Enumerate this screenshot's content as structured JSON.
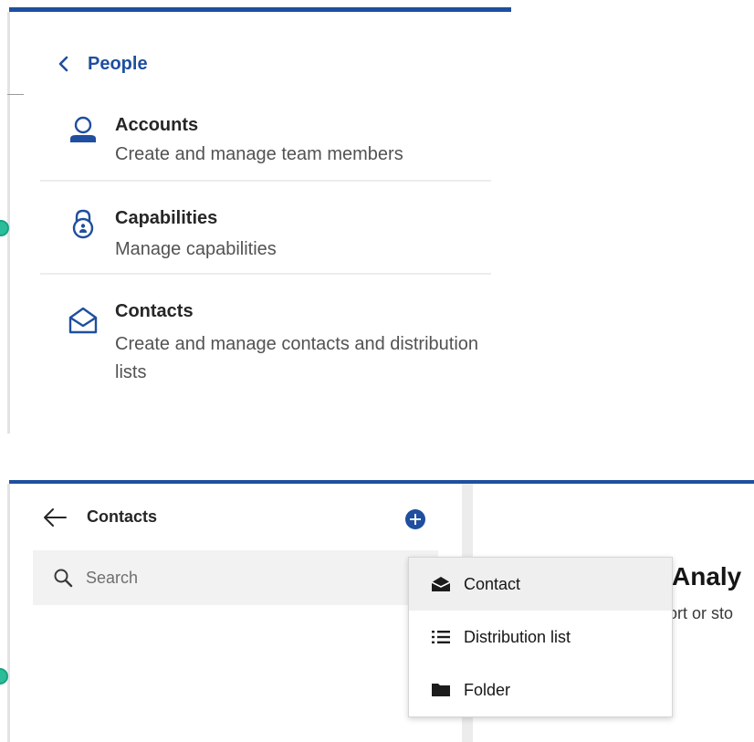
{
  "people_menu": {
    "back_label": "People",
    "items": [
      {
        "title": "Accounts",
        "description": "Create and manage team members",
        "icon": "user-icon"
      },
      {
        "title": "Capabilities",
        "description": "Manage capabilities",
        "icon": "lock-icon"
      },
      {
        "title": "Contacts",
        "description": "Create and manage contacts and distribution lists",
        "icon": "envelope-open-icon"
      }
    ]
  },
  "contacts_view": {
    "title": "Contacts",
    "search": {
      "placeholder": "Search",
      "value": ""
    },
    "background_heading": "Analy",
    "background_subtext": "ort or sto"
  },
  "add_menu": {
    "items": [
      {
        "label": "Contact",
        "icon": "contact-envelope-icon"
      },
      {
        "label": "Distribution list",
        "icon": "list-icon"
      },
      {
        "label": "Folder",
        "icon": "folder-icon"
      }
    ]
  },
  "colors": {
    "accent": "#1f4f9e",
    "status_dot": "#2bbd9a"
  }
}
